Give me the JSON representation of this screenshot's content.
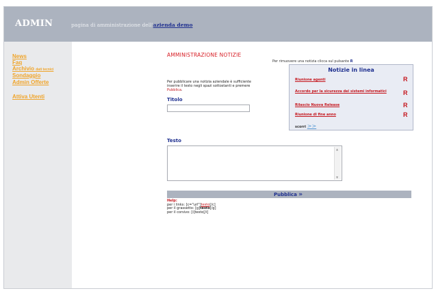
{
  "header": {
    "logo": "ADMIN",
    "subtitle": "pagina di amministrazione dell'",
    "company": "azienda demo"
  },
  "sidebar": {
    "items": [
      {
        "label": "News"
      },
      {
        "label": "Faq"
      },
      {
        "label": "Archivio",
        "small": "dati tecnici"
      },
      {
        "label": "Sondaggio"
      },
      {
        "label": "Admin Offerte"
      },
      {
        "label": "Attiva Utenti"
      }
    ]
  },
  "main": {
    "title": "AMMINISTRAZIONE NOTIZIE",
    "remove_hint": "Per rimuovere una notizia clicca sul pulsante",
    "remove_hint_key": "R",
    "intro": "Per pubblicare una notizia aziendale è sufficiente inserire il testo negli spazi sottostanti e premere",
    "intro_highlight": "Pubblica",
    "title_label": "Titolo",
    "text_label": "Testo",
    "publish_label": "Pubblica",
    "publish_arrow": "»",
    "news_box": {
      "title": "Notizie in linea",
      "items": [
        {
          "label": "Riunione agenti",
          "remove": "R"
        },
        {
          "label": "Accordo per la sicurezza dei sistemi informatici",
          "remove": "R"
        },
        {
          "label": "Rilascio Nuova Release",
          "remove": "R"
        },
        {
          "label": "Riunione di fine anno",
          "remove": "R"
        }
      ],
      "more_label": "scorri",
      "more_arrow": ">>"
    },
    "help": {
      "title": "Help:",
      "links_prefix": "per i links: [c=\"url\"]",
      "links_word": "testo",
      "links_suffix": "[/c]",
      "bold_prefix": "per il grassetto: [g]",
      "bold_word": "testo",
      "bold_suffix": "[/g]",
      "italic_line": "per il corsivo: [i]testo[/i]"
    }
  }
}
